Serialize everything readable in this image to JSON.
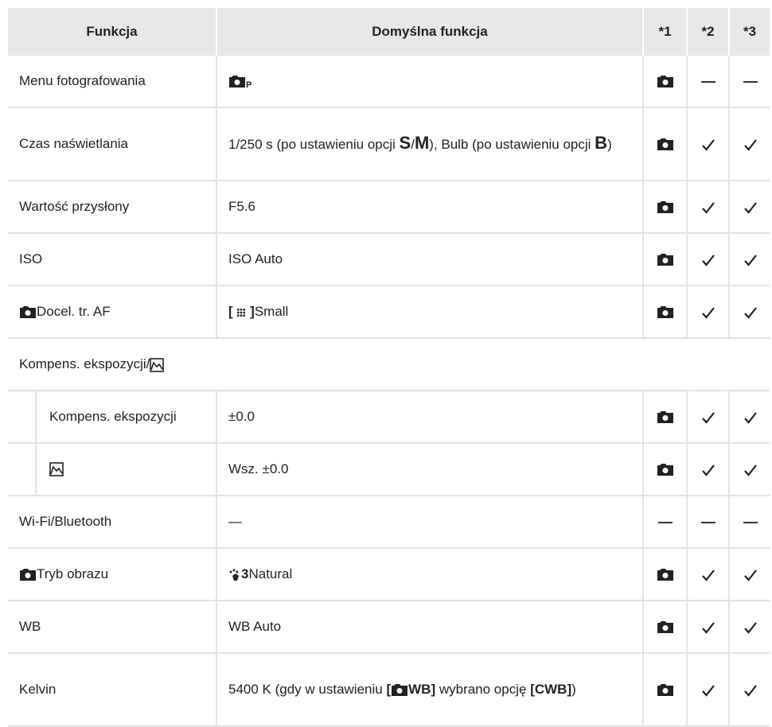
{
  "header": {
    "col1": "Funkcja",
    "col2": "Domyślna funkcja",
    "col3": "*1",
    "col4": "*2",
    "col5": "*3"
  },
  "rows": {
    "menu": {
      "name": "Menu fotografowania",
      "sub": "P"
    },
    "czas": {
      "name": "Czas naświetlania",
      "v1": "1/250 s (po ustawieniu opcji ",
      "s": "S",
      "slash": "/",
      "m": "M",
      "v2": "), Bulb (po ustawieniu opcji ",
      "b": "B",
      "v3": ")"
    },
    "przyslona": {
      "name": "Wartość przysłony",
      "value": "F5.6"
    },
    "iso": {
      "name": "ISO",
      "value": "ISO Auto"
    },
    "docel": {
      "name": "Docel. tr. AF",
      "value": "Small",
      "b1": "[",
      "b2": "]"
    },
    "kompens_group": {
      "name": "Kompens. ekspozycji/"
    },
    "kompens": {
      "name": "Kompens. ekspozycji",
      "value": "±0.0"
    },
    "hist": {
      "value": "Wsz. ±0.0"
    },
    "wifi": {
      "name": "Wi-Fi/Bluetooth",
      "value": "—"
    },
    "tryb": {
      "name": "Tryb obrazu",
      "num": "3",
      "value": "Natural"
    },
    "wb": {
      "name": "WB",
      "value": "WB Auto"
    },
    "kelvin": {
      "name": "Kelvin",
      "v1": "5400 K (gdy w ustawieniu ",
      "b1": "[",
      "wb": "WB]",
      "v2": " wybrano opcję ",
      "cwb": "[CWB]",
      "v3": ")"
    }
  },
  "icons": {
    "camera": "camera-icon",
    "check": "check-icon",
    "dash": "dash-icon",
    "histogram": "histogram-icon",
    "af-target": "af-target-icon",
    "picture-mode": "picture-mode-icon"
  }
}
